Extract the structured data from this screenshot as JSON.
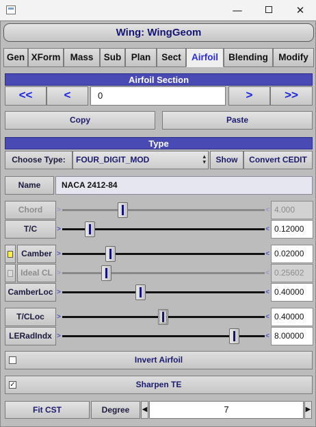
{
  "window": {
    "minimize": "—",
    "close": "✕"
  },
  "panel": {
    "title": "Wing: WingGeom"
  },
  "tabs": [
    "Gen",
    "XForm",
    "Mass",
    "Sub",
    "Plan",
    "Sect",
    "Airfoil",
    "Blending",
    "Modify"
  ],
  "active_tab": "Airfoil",
  "airfoil_section": {
    "header": "Airfoil Section",
    "first": "<<",
    "prev": "<",
    "index": "0",
    "next": ">",
    "last": ">>",
    "copy": "Copy",
    "paste": "Paste"
  },
  "type": {
    "header": "Type",
    "choose_label": "Choose Type:",
    "selected": "FOUR_DIGIT_MOD",
    "show": "Show",
    "convert": "Convert CEDIT",
    "name_label": "Name",
    "name_value": "NACA 2412-84"
  },
  "sliders": [
    {
      "label": "Chord",
      "value": "4.000",
      "fraction": 0.3,
      "enabled": false
    },
    {
      "label": "T/C",
      "value": "0.12000",
      "fraction": 0.14,
      "enabled": true
    },
    {
      "label": "Camber",
      "value": "0.02000",
      "fraction": 0.24,
      "enabled": true,
      "checkbox": true
    },
    {
      "label": "Ideal CL",
      "value": "0.25602",
      "fraction": 0.22,
      "enabled": false,
      "checkbox": true
    },
    {
      "label": "CamberLoc",
      "value": "0.40000",
      "fraction": 0.39,
      "enabled": true
    },
    {
      "label": "T/CLoc",
      "value": "0.40000",
      "fraction": 0.5,
      "enabled": true
    },
    {
      "label": "LERadIndx",
      "value": "8.00000",
      "fraction": 0.85,
      "enabled": true
    }
  ],
  "invert_airfoil": {
    "label": "Invert Airfoil",
    "checked": false
  },
  "sharpen_te": {
    "label": "Sharpen TE",
    "checked": true,
    "mark": "✓"
  },
  "fit": {
    "fit_label": "Fit CST",
    "degree_label": "Degree",
    "degree_value": "7",
    "dec": "◀",
    "inc": "▶"
  },
  "colors": {
    "header": "#4a4ab4",
    "active_tab_text": "#2a2ae0",
    "label_text": "#1a1a6e",
    "camber_flag": "#ffef40"
  }
}
